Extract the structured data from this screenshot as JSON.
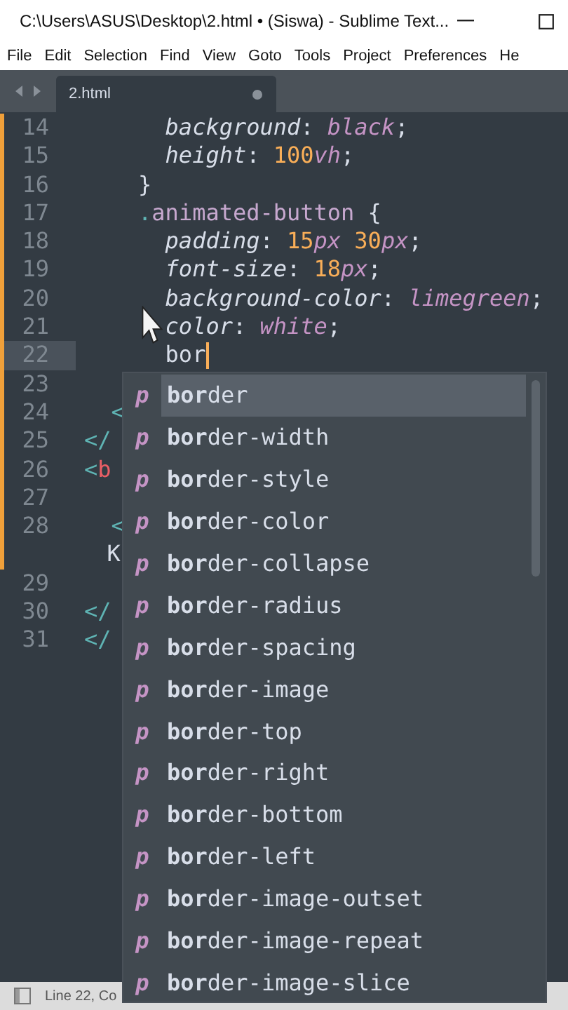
{
  "window": {
    "title": "C:\\Users\\ASUS\\Desktop\\2.html • (Siswa) - Sublime Text..."
  },
  "menu": [
    "File",
    "Edit",
    "Selection",
    "Find",
    "View",
    "Goto",
    "Tools",
    "Project",
    "Preferences",
    "He"
  ],
  "tabs": [
    {
      "label": "2.html",
      "selected": true,
      "modified": true
    }
  ],
  "editor": {
    "lines": [
      {
        "number": "14",
        "modified": true,
        "current": false,
        "tokens": [
          {
            "text": "      background",
            "kind": "prop"
          },
          {
            "text": ": ",
            "kind": "punct"
          },
          {
            "text": "black",
            "kind": "value"
          },
          {
            "text": ";",
            "kind": "punct"
          }
        ]
      },
      {
        "number": "15",
        "modified": true,
        "current": false,
        "tokens": [
          {
            "text": "      height",
            "kind": "prop"
          },
          {
            "text": ": ",
            "kind": "punct"
          },
          {
            "text": "100",
            "kind": "num"
          },
          {
            "text": "vh",
            "kind": "value"
          },
          {
            "text": ";",
            "kind": "punct"
          }
        ]
      },
      {
        "number": "16",
        "modified": true,
        "current": false,
        "tokens": [
          {
            "text": "    }",
            "kind": "plain"
          }
        ]
      },
      {
        "number": "17",
        "modified": true,
        "current": false,
        "tokens": [
          {
            "text": "    .",
            "kind": "dot"
          },
          {
            "text": "animated-button",
            "kind": "selector"
          },
          {
            "text": " {",
            "kind": "plain"
          }
        ]
      },
      {
        "number": "18",
        "modified": true,
        "current": false,
        "tokens": [
          {
            "text": "      padding",
            "kind": "prop"
          },
          {
            "text": ": ",
            "kind": "punct"
          },
          {
            "text": "15",
            "kind": "num"
          },
          {
            "text": "px",
            "kind": "value"
          },
          {
            "text": " 30",
            "kind": "num"
          },
          {
            "text": "px",
            "kind": "value"
          },
          {
            "text": ";",
            "kind": "punct"
          }
        ]
      },
      {
        "number": "19",
        "modified": true,
        "current": false,
        "tokens": [
          {
            "text": "      font-size",
            "kind": "prop"
          },
          {
            "text": ": ",
            "kind": "punct"
          },
          {
            "text": "18",
            "kind": "num"
          },
          {
            "text": "px",
            "kind": "value"
          },
          {
            "text": ";",
            "kind": "punct"
          }
        ]
      },
      {
        "number": "20",
        "modified": true,
        "current": false,
        "tokens": [
          {
            "text": "      background-color",
            "kind": "prop"
          },
          {
            "text": ": ",
            "kind": "punct"
          },
          {
            "text": "limegreen",
            "kind": "value"
          },
          {
            "text": ";",
            "kind": "punct"
          }
        ]
      },
      {
        "number": "21",
        "modified": true,
        "current": false,
        "tokens": [
          {
            "text": "      color",
            "kind": "prop"
          },
          {
            "text": ": ",
            "kind": "punct"
          },
          {
            "text": "white",
            "kind": "value"
          },
          {
            "text": ";",
            "kind": "punct"
          }
        ]
      },
      {
        "number": "22",
        "modified": true,
        "current": true,
        "caret": true,
        "tokens": [
          {
            "text": "      bor",
            "kind": "plain"
          }
        ]
      },
      {
        "number": "23",
        "modified": true,
        "current": false
      },
      {
        "number": "24",
        "modified": true,
        "current": false,
        "tokens": [
          {
            "text": "  <",
            "kind": "tagpunct"
          }
        ]
      },
      {
        "number": "25",
        "modified": true,
        "current": false,
        "tokens": [
          {
            "text": "</",
            "kind": "tagpunct"
          }
        ]
      },
      {
        "number": "26",
        "modified": true,
        "current": false,
        "tokens": [
          {
            "text": "<",
            "kind": "tagpunct"
          },
          {
            "text": "b",
            "kind": "tag"
          }
        ]
      },
      {
        "number": "27",
        "modified": true,
        "current": false
      },
      {
        "number": "28",
        "modified": true,
        "current": false,
        "tokens": [
          {
            "text": "  <",
            "kind": "tagpunct"
          }
        ],
        "wrap": [
          {
            "text": "  K",
            "kind": "plain"
          }
        ]
      },
      {
        "number": "29",
        "modified": false,
        "current": false
      },
      {
        "number": "30",
        "modified": false,
        "current": false,
        "tokens": [
          {
            "text": "</",
            "kind": "tagpunct"
          }
        ]
      },
      {
        "number": "31",
        "modified": false,
        "current": false,
        "tokens": [
          {
            "text": "</",
            "kind": "tagpunct"
          }
        ]
      }
    ]
  },
  "completions": [
    {
      "mark": "p",
      "text": "**bor**der",
      "selected": true
    },
    {
      "mark": "p",
      "text": "**bor**der-width",
      "selected": false
    },
    {
      "mark": "p",
      "text": "**bor**der-style",
      "selected": false
    },
    {
      "mark": "p",
      "text": "**bor**der-color",
      "selected": false
    },
    {
      "mark": "p",
      "text": "**bor**der-collapse",
      "selected": false
    },
    {
      "mark": "p",
      "text": "**bor**der-radius",
      "selected": false
    },
    {
      "mark": "p",
      "text": "**bor**der-spacing",
      "selected": false
    },
    {
      "mark": "p",
      "text": "**bor**der-image",
      "selected": false
    },
    {
      "mark": "p",
      "text": "**bor**der-top",
      "selected": false
    },
    {
      "mark": "p",
      "text": "**bor**der-right",
      "selected": false
    },
    {
      "mark": "p",
      "text": "**bor**der-bottom",
      "selected": false
    },
    {
      "mark": "p",
      "text": "**bor**der-left",
      "selected": false
    },
    {
      "mark": "p",
      "text": "**bor**der-image-outset",
      "selected": false
    },
    {
      "mark": "p",
      "text": "**bor**der-image-repeat",
      "selected": false
    },
    {
      "mark": "p",
      "text": "**bor**der-image-slice",
      "selected": false
    }
  ],
  "status_bar": {
    "text": "Line 22, Co"
  }
}
